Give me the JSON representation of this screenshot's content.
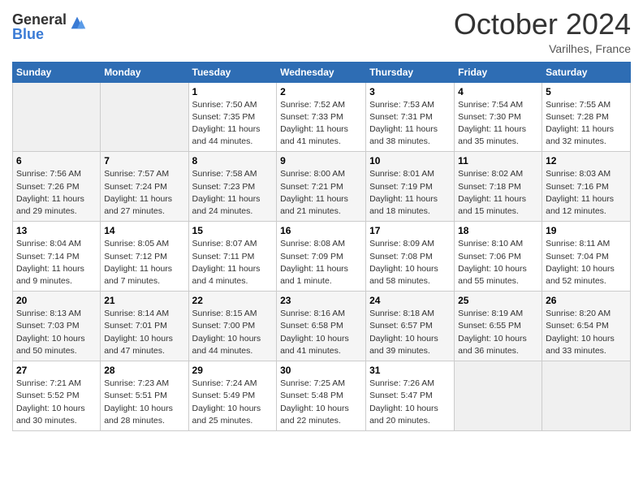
{
  "header": {
    "logo_general": "General",
    "logo_blue": "Blue",
    "month_title": "October 2024",
    "location": "Varilhes, France"
  },
  "weekdays": [
    "Sunday",
    "Monday",
    "Tuesday",
    "Wednesday",
    "Thursday",
    "Friday",
    "Saturday"
  ],
  "weeks": [
    [
      null,
      null,
      {
        "day": "1",
        "sunrise": "7:50 AM",
        "sunset": "7:35 PM",
        "daylight": "11 hours and 44 minutes."
      },
      {
        "day": "2",
        "sunrise": "7:52 AM",
        "sunset": "7:33 PM",
        "daylight": "11 hours and 41 minutes."
      },
      {
        "day": "3",
        "sunrise": "7:53 AM",
        "sunset": "7:31 PM",
        "daylight": "11 hours and 38 minutes."
      },
      {
        "day": "4",
        "sunrise": "7:54 AM",
        "sunset": "7:30 PM",
        "daylight": "11 hours and 35 minutes."
      },
      {
        "day": "5",
        "sunrise": "7:55 AM",
        "sunset": "7:28 PM",
        "daylight": "11 hours and 32 minutes."
      }
    ],
    [
      {
        "day": "6",
        "sunrise": "7:56 AM",
        "sunset": "7:26 PM",
        "daylight": "11 hours and 29 minutes."
      },
      {
        "day": "7",
        "sunrise": "7:57 AM",
        "sunset": "7:24 PM",
        "daylight": "11 hours and 27 minutes."
      },
      {
        "day": "8",
        "sunrise": "7:58 AM",
        "sunset": "7:23 PM",
        "daylight": "11 hours and 24 minutes."
      },
      {
        "day": "9",
        "sunrise": "8:00 AM",
        "sunset": "7:21 PM",
        "daylight": "11 hours and 21 minutes."
      },
      {
        "day": "10",
        "sunrise": "8:01 AM",
        "sunset": "7:19 PM",
        "daylight": "11 hours and 18 minutes."
      },
      {
        "day": "11",
        "sunrise": "8:02 AM",
        "sunset": "7:18 PM",
        "daylight": "11 hours and 15 minutes."
      },
      {
        "day": "12",
        "sunrise": "8:03 AM",
        "sunset": "7:16 PM",
        "daylight": "11 hours and 12 minutes."
      }
    ],
    [
      {
        "day": "13",
        "sunrise": "8:04 AM",
        "sunset": "7:14 PM",
        "daylight": "11 hours and 9 minutes."
      },
      {
        "day": "14",
        "sunrise": "8:05 AM",
        "sunset": "7:12 PM",
        "daylight": "11 hours and 7 minutes."
      },
      {
        "day": "15",
        "sunrise": "8:07 AM",
        "sunset": "7:11 PM",
        "daylight": "11 hours and 4 minutes."
      },
      {
        "day": "16",
        "sunrise": "8:08 AM",
        "sunset": "7:09 PM",
        "daylight": "11 hours and 1 minute."
      },
      {
        "day": "17",
        "sunrise": "8:09 AM",
        "sunset": "7:08 PM",
        "daylight": "10 hours and 58 minutes."
      },
      {
        "day": "18",
        "sunrise": "8:10 AM",
        "sunset": "7:06 PM",
        "daylight": "10 hours and 55 minutes."
      },
      {
        "day": "19",
        "sunrise": "8:11 AM",
        "sunset": "7:04 PM",
        "daylight": "10 hours and 52 minutes."
      }
    ],
    [
      {
        "day": "20",
        "sunrise": "8:13 AM",
        "sunset": "7:03 PM",
        "daylight": "10 hours and 50 minutes."
      },
      {
        "day": "21",
        "sunrise": "8:14 AM",
        "sunset": "7:01 PM",
        "daylight": "10 hours and 47 minutes."
      },
      {
        "day": "22",
        "sunrise": "8:15 AM",
        "sunset": "7:00 PM",
        "daylight": "10 hours and 44 minutes."
      },
      {
        "day": "23",
        "sunrise": "8:16 AM",
        "sunset": "6:58 PM",
        "daylight": "10 hours and 41 minutes."
      },
      {
        "day": "24",
        "sunrise": "8:18 AM",
        "sunset": "6:57 PM",
        "daylight": "10 hours and 39 minutes."
      },
      {
        "day": "25",
        "sunrise": "8:19 AM",
        "sunset": "6:55 PM",
        "daylight": "10 hours and 36 minutes."
      },
      {
        "day": "26",
        "sunrise": "8:20 AM",
        "sunset": "6:54 PM",
        "daylight": "10 hours and 33 minutes."
      }
    ],
    [
      {
        "day": "27",
        "sunrise": "7:21 AM",
        "sunset": "5:52 PM",
        "daylight": "10 hours and 30 minutes."
      },
      {
        "day": "28",
        "sunrise": "7:23 AM",
        "sunset": "5:51 PM",
        "daylight": "10 hours and 28 minutes."
      },
      {
        "day": "29",
        "sunrise": "7:24 AM",
        "sunset": "5:49 PM",
        "daylight": "10 hours and 25 minutes."
      },
      {
        "day": "30",
        "sunrise": "7:25 AM",
        "sunset": "5:48 PM",
        "daylight": "10 hours and 22 minutes."
      },
      {
        "day": "31",
        "sunrise": "7:26 AM",
        "sunset": "5:47 PM",
        "daylight": "10 hours and 20 minutes."
      },
      null,
      null
    ]
  ]
}
